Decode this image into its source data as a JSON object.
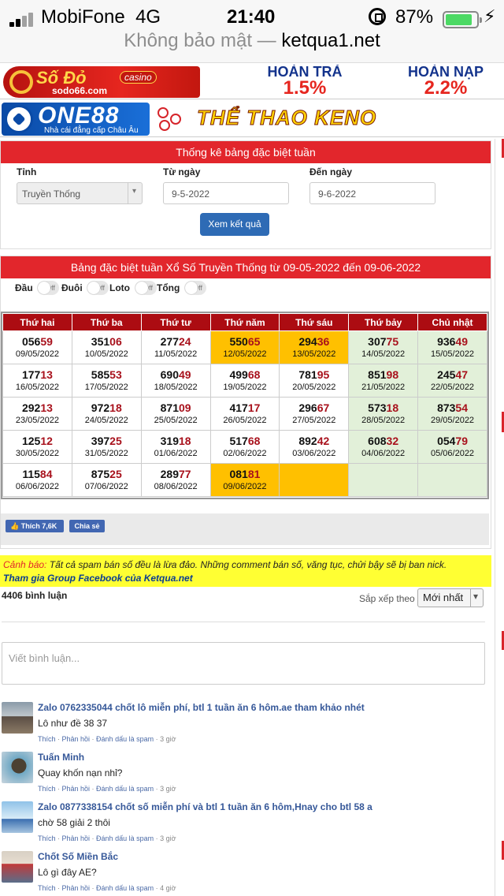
{
  "status_bar": {
    "carrier": "MobiFone",
    "network": "4G",
    "time": "21:40",
    "battery_percent": "87%",
    "battery_level": 0.87,
    "icons": [
      "signal-icon",
      "orientation-lock-icon",
      "battery-icon",
      "charging-icon"
    ]
  },
  "address_bar": {
    "insecure_label": "Không bảo mật —",
    "host": "ketqua1.net"
  },
  "ads": {
    "sodo": {
      "brand": "Số Đỏ",
      "badge": "casino",
      "site": "sodo66.com",
      "promo1_label": "HOÀN TRẢ",
      "promo1_value": "1.5%",
      "promo2_label": "HOÀN NẠP",
      "promo2_value": "2.2%"
    },
    "one88": {
      "brand": "ONE88",
      "tagline": "Nhà cái đẳng cấp Châu Âu",
      "words": "THỂ THAO   KENO"
    }
  },
  "filter": {
    "title": "Thống kê bảng đặc biệt tuần",
    "province_label": "Tỉnh",
    "province_value": "Truyền Thống",
    "from_label": "Từ ngày",
    "from_value": "9-5-2022",
    "to_label": "Đến ngày",
    "to_value": "9-6-2022",
    "submit": "Xem kết quả"
  },
  "results": {
    "title": "Bảng đặc biệt tuần Xổ Số Truyền Thống từ 09-05-2022 đến 09-06-2022",
    "toggles": [
      {
        "label": "Đầu",
        "state": "Off"
      },
      {
        "label": "Đuôi",
        "state": "Off"
      },
      {
        "label": "Loto",
        "state": "Off"
      },
      {
        "label": "Tổng",
        "state": "Off"
      }
    ],
    "days": [
      "Thứ hai",
      "Thứ ba",
      "Thứ tư",
      "Thứ năm",
      "Thứ sáu",
      "Thứ bảy",
      "Chủ nhật"
    ],
    "rows": [
      [
        {
          "head": "056",
          "tail": "59",
          "date": "09/05/2022"
        },
        {
          "head": "351",
          "tail": "06",
          "date": "10/05/2022"
        },
        {
          "head": "277",
          "tail": "24",
          "date": "11/05/2022"
        },
        {
          "head": "550",
          "tail": "65",
          "date": "12/05/2022",
          "hl": true
        },
        {
          "head": "294",
          "tail": "36",
          "date": "13/05/2022",
          "hl": true
        },
        {
          "head": "307",
          "tail": "75",
          "date": "14/05/2022",
          "gr": true
        },
        {
          "head": "936",
          "tail": "49",
          "date": "15/05/2022",
          "gr": true
        }
      ],
      [
        {
          "head": "177",
          "tail": "13",
          "date": "16/05/2022"
        },
        {
          "head": "585",
          "tail": "53",
          "date": "17/05/2022"
        },
        {
          "head": "690",
          "tail": "49",
          "date": "18/05/2022"
        },
        {
          "head": "499",
          "tail": "68",
          "date": "19/05/2022"
        },
        {
          "head": "781",
          "tail": "95",
          "date": "20/05/2022"
        },
        {
          "head": "851",
          "tail": "98",
          "date": "21/05/2022",
          "gr": true
        },
        {
          "head": "245",
          "tail": "47",
          "date": "22/05/2022",
          "gr": true
        }
      ],
      [
        {
          "head": "292",
          "tail": "13",
          "date": "23/05/2022"
        },
        {
          "head": "972",
          "tail": "18",
          "date": "24/05/2022"
        },
        {
          "head": "871",
          "tail": "09",
          "date": "25/05/2022"
        },
        {
          "head": "417",
          "tail": "17",
          "date": "26/05/2022"
        },
        {
          "head": "296",
          "tail": "67",
          "date": "27/05/2022"
        },
        {
          "head": "573",
          "tail": "18",
          "date": "28/05/2022",
          "gr": true
        },
        {
          "head": "873",
          "tail": "54",
          "date": "29/05/2022",
          "gr": true
        }
      ],
      [
        {
          "head": "125",
          "tail": "12",
          "date": "30/05/2022"
        },
        {
          "head": "397",
          "tail": "25",
          "date": "31/05/2022"
        },
        {
          "head": "319",
          "tail": "18",
          "date": "01/06/2022"
        },
        {
          "head": "517",
          "tail": "68",
          "date": "02/06/2022"
        },
        {
          "head": "892",
          "tail": "42",
          "date": "03/06/2022"
        },
        {
          "head": "608",
          "tail": "32",
          "date": "04/06/2022",
          "gr": true
        },
        {
          "head": "054",
          "tail": "79",
          "date": "05/06/2022",
          "gr": true
        }
      ],
      [
        {
          "head": "115",
          "tail": "84",
          "date": "06/06/2022"
        },
        {
          "head": "875",
          "tail": "25",
          "date": "07/06/2022"
        },
        {
          "head": "289",
          "tail": "77",
          "date": "08/06/2022"
        },
        {
          "head": "081",
          "tail": "81",
          "date": "09/06/2022",
          "hl": true
        },
        {
          "head": "",
          "tail": "",
          "date": "",
          "hl": true
        },
        {
          "head": "",
          "tail": "",
          "date": "",
          "gr": true
        },
        {
          "head": "",
          "tail": "",
          "date": "",
          "gr": true
        }
      ]
    ],
    "like_label": "Thích 7,6K",
    "share_label": "Chia sẻ"
  },
  "comments": {
    "warning_label": "Cảnh báo:",
    "warning_text": "Tất cả spam bán số đều là lừa đảo. Những comment bán số, văng tục, chửi bậy sẽ bị ban nick.",
    "group_link": "Tham gia Group Facebook của Ketqua.net",
    "count": "4406 bình luận",
    "sort_label": "Sắp xếp theo",
    "sort_value": "Mới nhất",
    "placeholder": "Viết bình luận...",
    "list": [
      {
        "name": "Zalo 0762335044 chốt lô miễn phí, btl 1 tuần ăn 6 hôm.ae tham khảo nhét",
        "text": "Lô như đề 38 37",
        "like": "Thích",
        "reply": "Phản hồi",
        "spam": "Đánh dấu là spam",
        "time": "3 giờ"
      },
      {
        "name": "Tuấn Minh",
        "text": "Quay khốn nạn nhỉ?",
        "like": "Thích",
        "reply": "Phản hồi",
        "spam": "Đánh dấu là spam",
        "time": "3 giờ"
      },
      {
        "name": "Zalo 0877338154 chốt số miễn phí và btl 1 tuần ăn 6 hôm,Hnay cho btl 58 a",
        "text": "chờ 58 giải 2 thôi",
        "like": "Thích",
        "reply": "Phản hồi",
        "spam": "Đánh dấu là spam",
        "time": "3 giờ"
      },
      {
        "name": "Chốt Số Miền Bắc",
        "text": "Lô gì đây AE?",
        "like": "Thích",
        "reply": "Phản hồi",
        "spam": "Đánh dấu là spam",
        "time": "4 giờ"
      }
    ]
  },
  "colors": {
    "header_red": "#e2262c",
    "day_header": "#ac0c12",
    "highlight_yellow": "#ffc000",
    "weekend_green": "#e2f0d9",
    "tail_red": "#a8111c",
    "button_blue": "#2e6bb5",
    "link_blue": "#365899"
  }
}
